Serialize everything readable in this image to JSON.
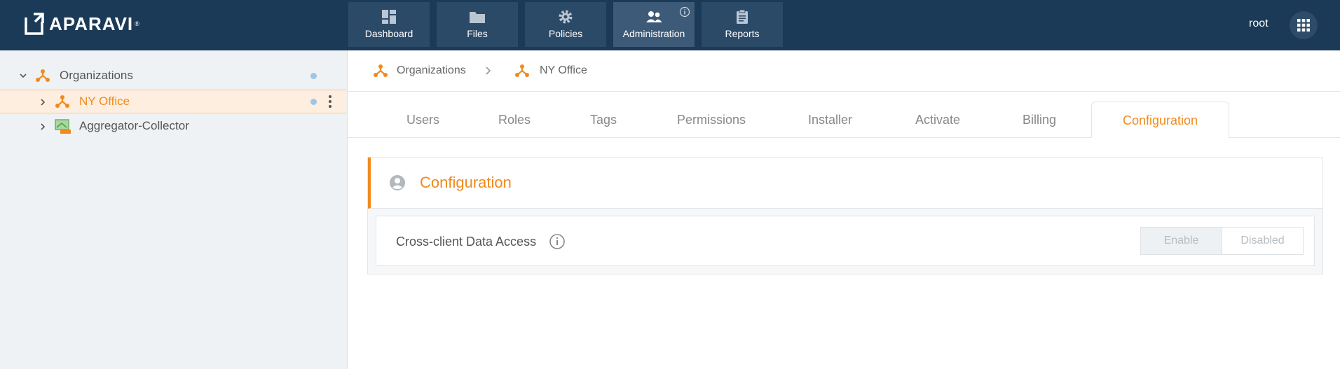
{
  "app": {
    "brand": "APARAVI",
    "brand_mark": "®",
    "user": "root"
  },
  "nav": [
    {
      "label": "Dashboard",
      "icon": "dashboard-icon"
    },
    {
      "label": "Files",
      "icon": "folder-icon"
    },
    {
      "label": "Policies",
      "icon": "gear-icon"
    },
    {
      "label": "Administration",
      "icon": "people-icon",
      "active": true
    },
    {
      "label": "Reports",
      "icon": "clipboard-icon"
    }
  ],
  "sidebar": {
    "items": [
      {
        "label": "Organizations",
        "expanded": true
      },
      {
        "label": "NY Office",
        "selected": true
      },
      {
        "label": "Aggregator-Collector"
      }
    ]
  },
  "breadcrumb": {
    "items": [
      "Organizations",
      "NY Office"
    ]
  },
  "tabs": [
    "Users",
    "Roles",
    "Tags",
    "Permissions",
    "Installer",
    "Activate",
    "Billing",
    "Configuration"
  ],
  "active_tab": "Configuration",
  "panel": {
    "title": "Configuration",
    "setting_label": "Cross-client Data Access",
    "enable_label": "Enable",
    "disabled_label": "Disabled"
  },
  "colors": {
    "topbar": "#1b3a57",
    "accent": "#f08a1c",
    "sidebar_bg": "#eef2f5"
  }
}
